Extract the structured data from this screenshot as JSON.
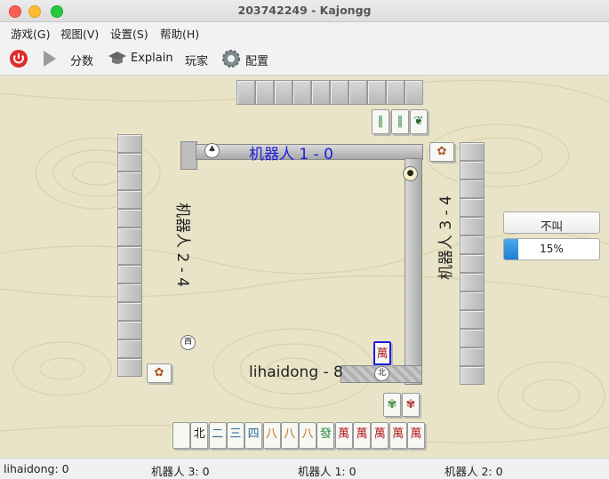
{
  "window": {
    "title": "203742249 - Kajongg"
  },
  "menu": [
    "游戏(G)",
    "视图(V)",
    "设置(S)",
    "帮助(H)"
  ],
  "toolbar": {
    "score": "分数",
    "explain": "Explain",
    "players": "玩家",
    "config": "配置"
  },
  "players": {
    "top": "机器人 1 - 0",
    "left": "机器人 2 - 4",
    "right": "机器人 3 - 4",
    "bottom": "lihaidong - 8"
  },
  "controls": {
    "claim_button": "不叫",
    "progress_text": "15%",
    "progress_value": 0.15
  },
  "hand_tiles": [
    "",
    "北",
    "二",
    "三",
    "四",
    "八",
    "八",
    "八",
    "發",
    "萬",
    "萬",
    "萬",
    "萬",
    "萬"
  ],
  "discard_selected": "萬",
  "status": [
    "lihaidong: 0",
    "机器人 3: 0",
    "机器人 1: 0",
    "机器人 2: 0"
  ]
}
